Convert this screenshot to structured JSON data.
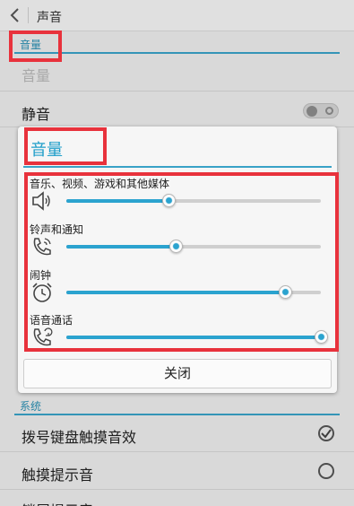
{
  "header": {
    "title": "声音"
  },
  "background": {
    "volume_section_header": "音量",
    "volume_row_label": "音量",
    "silent_label": "静音",
    "system_section_header": "系统",
    "rows": [
      {
        "label": "拨号键盘触摸音效",
        "checked": true
      },
      {
        "label": "触摸提示音",
        "checked": false
      },
      {
        "label": "锁屏提示音",
        "checked": false
      }
    ]
  },
  "dialog": {
    "title": "音量",
    "sliders": [
      {
        "label": "音乐、视频、游戏和其他媒体",
        "icon": "speaker-icon",
        "value": 0.4
      },
      {
        "label": "铃声和通知",
        "icon": "phone-ring-icon",
        "value": 0.43
      },
      {
        "label": "闹钟",
        "icon": "alarm-clock-icon",
        "value": 0.86
      },
      {
        "label": "语音通话",
        "icon": "phone-call-icon",
        "value": 1.0
      }
    ],
    "close_label": "关闭"
  },
  "colors": {
    "accent": "#2ba3cf",
    "annotation": "#e8323c"
  }
}
